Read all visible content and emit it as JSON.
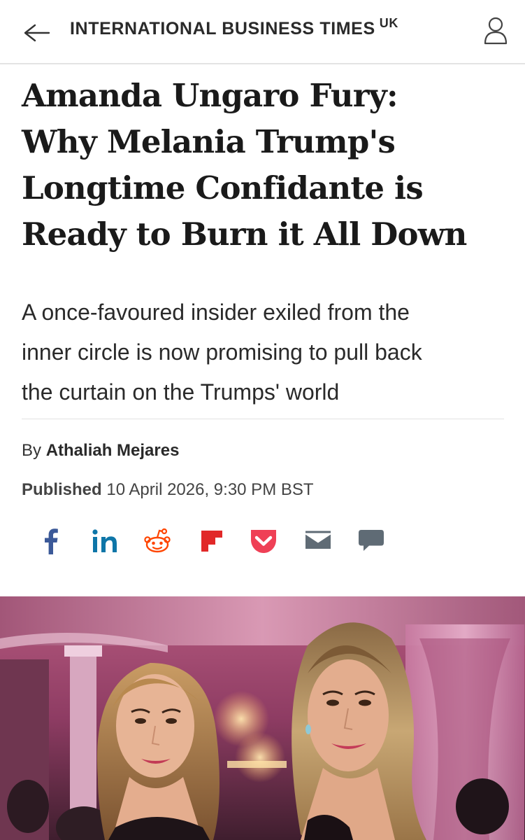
{
  "header": {
    "brand": "INTERNATIONAL BUSINESS TIMES",
    "edition": "UK",
    "back_icon": "arrow-left-icon",
    "account_icon": "user-icon"
  },
  "article": {
    "headline_lines": [
      "Amanda Ungaro Fury:",
      "Why Melania Trump's",
      "Longtime Confidante is",
      "Ready to Burn it All Down"
    ],
    "standfirst_lines": [
      "A once-favoured insider exiled from the",
      "inner circle is now promising to pull back",
      "the curtain on the Trumps' world"
    ],
    "byline_prefix": "By",
    "author": "Athaliah Mejares",
    "published_label": "Published",
    "published_date": "10 April 2026, 9:30 PM BST"
  },
  "share": [
    {
      "icon": "facebook-icon",
      "color": "#3b5998"
    },
    {
      "icon": "linkedin-icon",
      "color": "#0e76a8"
    },
    {
      "icon": "reddit-icon",
      "color": "#ff4500"
    },
    {
      "icon": "flipboard-icon",
      "color": "#e12828"
    },
    {
      "icon": "pocket-icon",
      "color": "#ef4056"
    },
    {
      "icon": "email-icon",
      "color": "#5f6b75"
    },
    {
      "icon": "comment-icon",
      "color": "#5f6b75"
    }
  ]
}
